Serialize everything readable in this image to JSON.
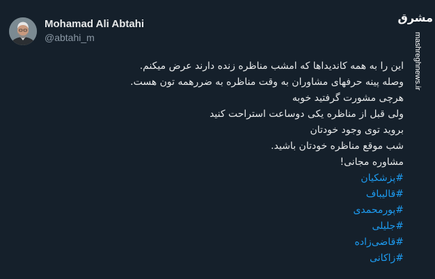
{
  "tweet": {
    "author": {
      "name": "Mohamad Ali Abtahi",
      "handle": "@abtahi_m"
    },
    "lines": [
      "این را به همه کاندیداها که امشب مناظره زنده دارند عرض میکنم.",
      "وصله پینه حرفهای مشاوران به وقت مناظره به ضررهمه تون هست.",
      "هرچی مشورت گرفتید خوبه",
      "ولی قبل از مناظره یکی دوساعت استراحت کنید",
      "بروید توی وجود خودتان",
      "شب موقع مناظره خودتان باشید.",
      "مشاوره مجانی!"
    ],
    "hashtags": [
      "#پزشکیان",
      "#قالیباف",
      "#پورمحمدی",
      "#جلیلی",
      "#قاضی‌زاده",
      "#زاکانی"
    ]
  },
  "watermark": {
    "logo": "مشرق",
    "url": "mashreghnews.ir"
  },
  "colors": {
    "background": "#15202b",
    "text": "#e7e9ea",
    "secondary": "#8b98a5",
    "link": "#1d9bf0"
  }
}
